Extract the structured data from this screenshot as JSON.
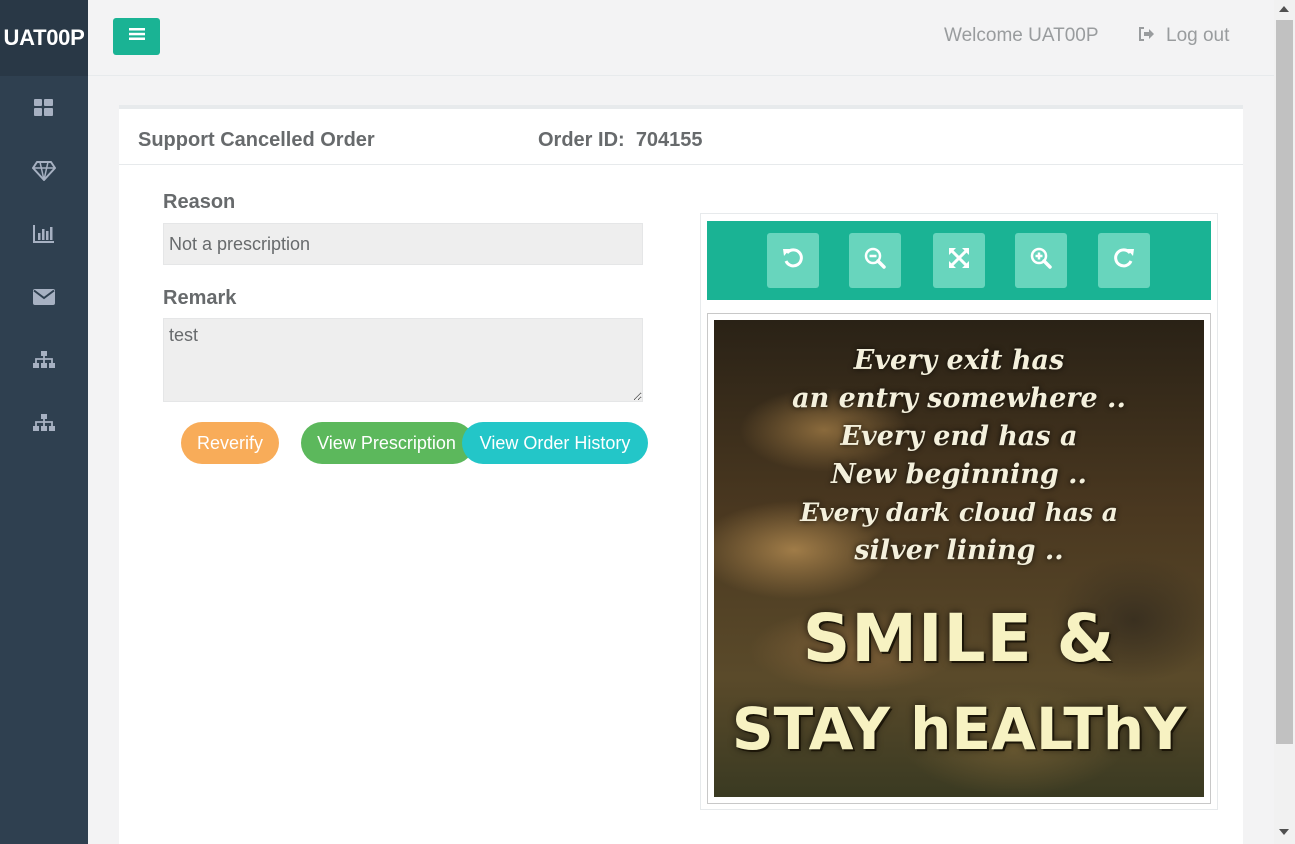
{
  "app": {
    "brand": "UAT00P"
  },
  "sidebar": {
    "items": [
      {
        "icon": "dashboard-icon"
      },
      {
        "icon": "diamond-icon"
      },
      {
        "icon": "bar-chart-icon"
      },
      {
        "icon": "envelope-icon"
      },
      {
        "icon": "sitemap-icon"
      },
      {
        "icon": "sitemap-icon"
      }
    ]
  },
  "header": {
    "welcome": "Welcome UAT00P",
    "logout_label": "Log out",
    "accent": "#1ab394"
  },
  "panel": {
    "title": "Support Cancelled Order",
    "order_id_label": "Order ID:",
    "order_id": "704155"
  },
  "form": {
    "reason_label": "Reason",
    "reason_value": "Not a prescription",
    "remark_label": "Remark",
    "remark_value": "test"
  },
  "actions": {
    "reverify": "Reverify",
    "view_prescription": "View Prescription",
    "view_order_history": "View Order History"
  },
  "viewer": {
    "tools": [
      "rotate-left-icon",
      "zoom-out-icon",
      "fit-screen-icon",
      "zoom-in-icon",
      "rotate-right-icon"
    ],
    "image_text": {
      "lines": [
        "Every exit has",
        "an entry somewhere ..",
        "Every end has a",
        "New beginning ..",
        "Every dark cloud has a",
        "silver lining .."
      ],
      "headline_1": "SMILE &",
      "headline_2": "STAY hEALThY"
    }
  }
}
